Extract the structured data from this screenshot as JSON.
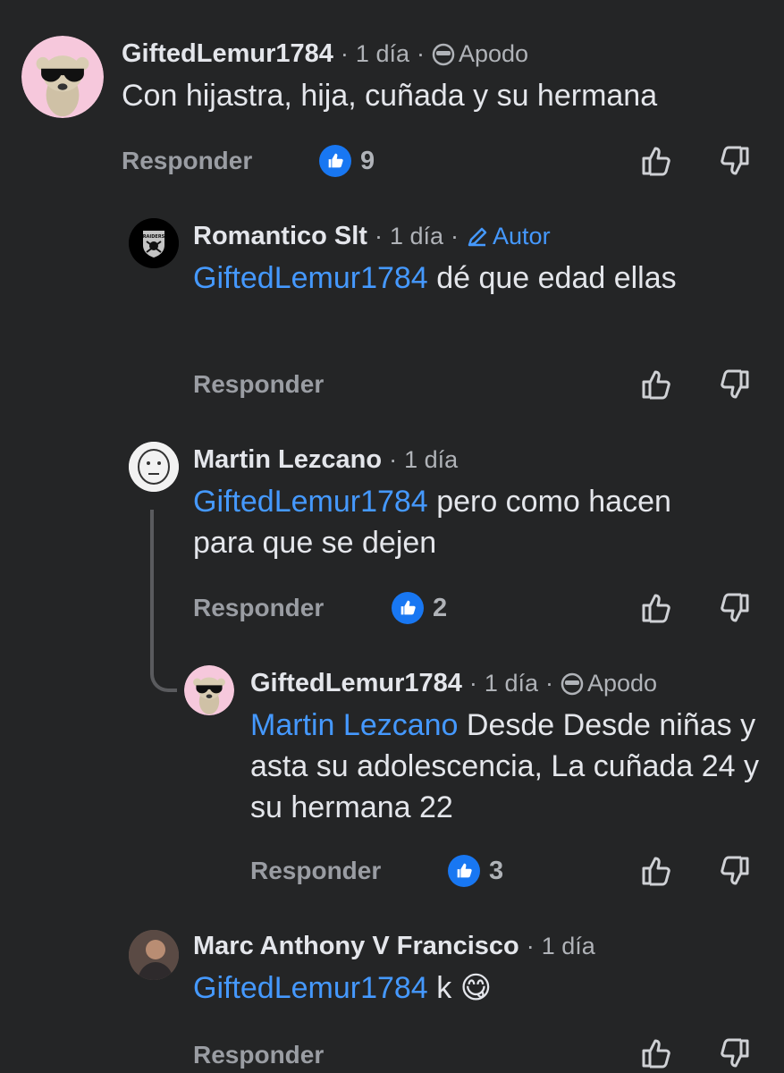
{
  "comments": [
    {
      "author": "GiftedLemur1784",
      "time": "1 día",
      "badge": "Apodo",
      "text": "Con hijastra, hija, cuñada y su hermana",
      "reply_label": "Responder",
      "likes": "9"
    },
    {
      "author": "Romantico Slt",
      "time": "1 día",
      "badge": "Autor",
      "mention": "GiftedLemur1784",
      "text": "dé que edad ellas",
      "reply_label": "Responder"
    },
    {
      "author": "Martin Lezcano",
      "time": "1 día",
      "mention": "GiftedLemur1784",
      "text": "pero como hacen para que se dejen",
      "reply_label": "Responder",
      "likes": "2"
    },
    {
      "author": "GiftedLemur1784",
      "time": "1 día",
      "badge": "Apodo",
      "mention": "Martin Lezcano",
      "text": "Desde Desde niñas y asta su adolescencia, La cuñada 24 y su hermana 22",
      "reply_label": "Responder",
      "likes": "3"
    },
    {
      "author": "Marc Anthony V Francisco",
      "time": "1 día",
      "mention": "GiftedLemur1784",
      "text": "k 😋",
      "reply_label": "Responder"
    }
  ],
  "separator": "·",
  "avatar_raiders_text": "RAIDERS",
  "icons": {
    "like_badge": "thumbs-up-icon",
    "upvote": "thumbs-up-outline-icon",
    "downvote": "thumbs-down-outline-icon",
    "apodo": "sunglasses-face-icon",
    "autor": "pencil-icon"
  },
  "colors": {
    "background": "#242526",
    "link": "#4599ff",
    "like_blue": "#1877f2",
    "muted": "#b0b3b8"
  }
}
